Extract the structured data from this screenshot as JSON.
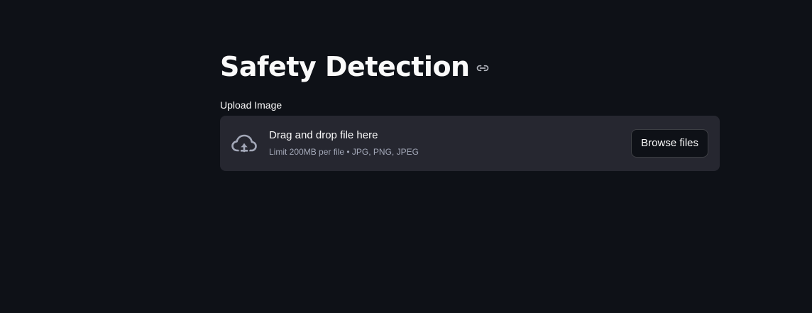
{
  "page": {
    "title": "Safety Detection"
  },
  "uploader": {
    "label": "Upload Image",
    "drop_text": "Drag and drop file here",
    "limit_text": "Limit 200MB per file • JPG, PNG, JPEG",
    "browse_label": "Browse files"
  },
  "icons": {
    "anchor": "link-icon",
    "upload": "cloud-upload-icon"
  },
  "colors": {
    "background": "#0e1117",
    "dropzone": "#262730",
    "text": "#fafafa",
    "muted_text": "#a3a8b8"
  }
}
